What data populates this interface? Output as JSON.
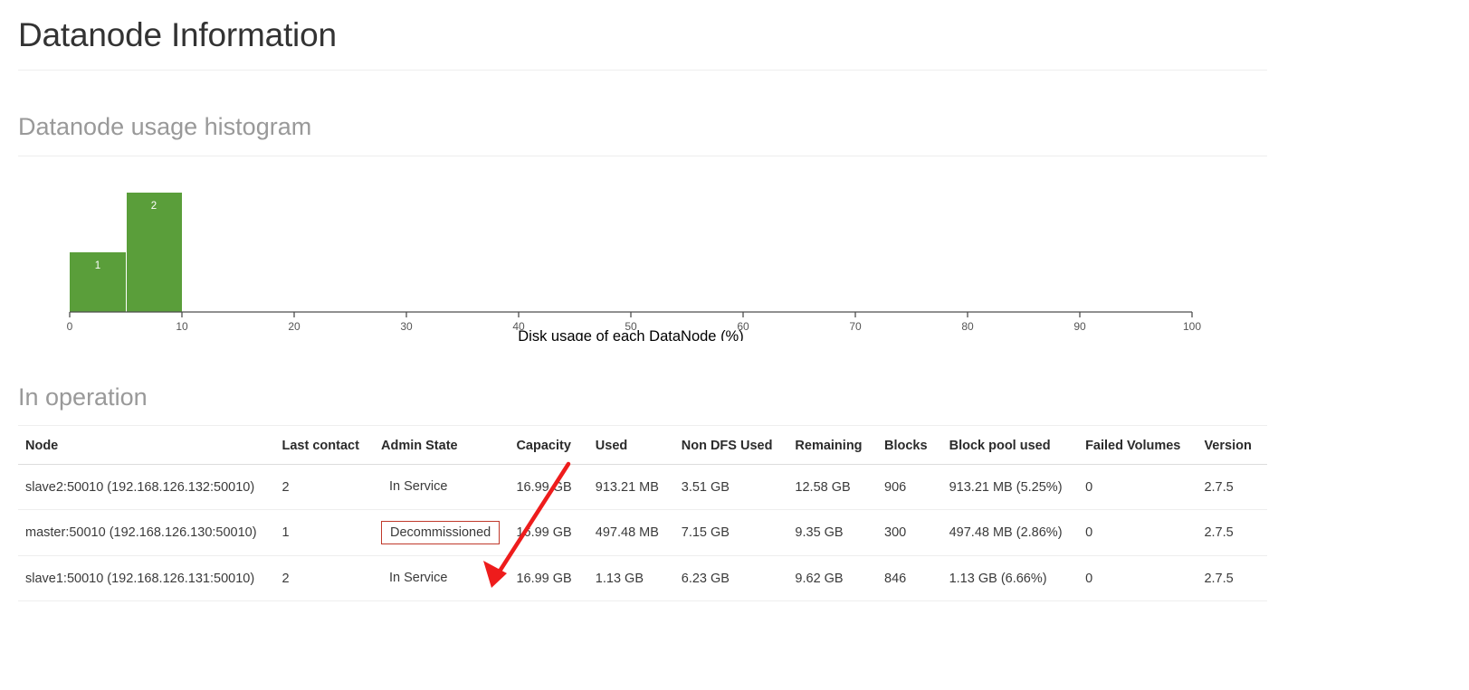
{
  "page": {
    "title": "Datanode Information"
  },
  "histogram_section": {
    "heading": "Datanode usage histogram"
  },
  "chart_data": {
    "type": "bar",
    "title": "Datanode usage histogram",
    "xlabel": "Disk usage of each DataNode (%)",
    "ylabel": "",
    "xlim": [
      0,
      100
    ],
    "ylim": [
      0,
      2
    ],
    "grid": false,
    "legend": null,
    "bar_color": "#5a9e3a",
    "bins": [
      {
        "x0": 0,
        "x1": 5,
        "count": 1,
        "label": "1"
      },
      {
        "x0": 5,
        "x1": 10,
        "count": 2,
        "label": "2"
      }
    ],
    "categories": [
      "0-5",
      "5-10"
    ],
    "values": [
      1,
      2
    ],
    "xticks": [
      0,
      10,
      20,
      30,
      40,
      50,
      60,
      70,
      80,
      90,
      100
    ],
    "xtick_labels": [
      "0",
      "10",
      "20",
      "30",
      "40",
      "50",
      "60",
      "70",
      "80",
      "90",
      "100"
    ]
  },
  "operation_section": {
    "heading": "In operation"
  },
  "table": {
    "headers": [
      "Node",
      "Last contact",
      "Admin State",
      "Capacity",
      "Used",
      "Non DFS Used",
      "Remaining",
      "Blocks",
      "Block pool used",
      "Failed Volumes",
      "Version"
    ],
    "rows": [
      {
        "node": "slave2:50010 (192.168.126.132:50010)",
        "last_contact": "2",
        "admin_state": "In Service",
        "admin_highlighted": false,
        "capacity": "16.99 GB",
        "used": "913.21 MB",
        "non_dfs_used": "3.51 GB",
        "remaining": "12.58 GB",
        "blocks": "906",
        "block_pool_used": "913.21 MB (5.25%)",
        "failed_volumes": "0",
        "version": "2.7.5"
      },
      {
        "node": "master:50010 (192.168.126.130:50010)",
        "last_contact": "1",
        "admin_state": "Decommissioned",
        "admin_highlighted": true,
        "capacity": "16.99 GB",
        "used": "497.48 MB",
        "non_dfs_used": "7.15 GB",
        "remaining": "9.35 GB",
        "blocks": "300",
        "block_pool_used": "497.48 MB (2.86%)",
        "failed_volumes": "0",
        "version": "2.7.5"
      },
      {
        "node": "slave1:50010 (192.168.126.131:50010)",
        "last_contact": "2",
        "admin_state": "In Service",
        "admin_highlighted": false,
        "capacity": "16.99 GB",
        "used": "1.13 GB",
        "non_dfs_used": "6.23 GB",
        "remaining": "9.62 GB",
        "blocks": "846",
        "block_pool_used": "1.13 GB (6.66%)",
        "failed_volumes": "0",
        "version": "2.7.5"
      }
    ]
  },
  "annotation": {
    "arrow_color": "#ee1c1c",
    "highlight_color": "#c0392b"
  }
}
